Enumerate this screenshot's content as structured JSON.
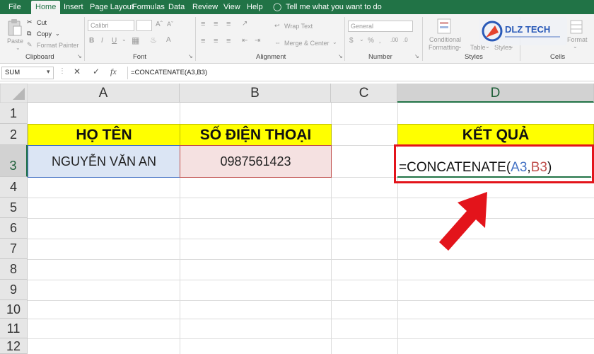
{
  "tabs": [
    "File",
    "Home",
    "Insert",
    "Page Layout",
    "Formulas",
    "Data",
    "Review",
    "View",
    "Help"
  ],
  "tell_me": "Tell me what you want to do",
  "ribbon": {
    "clipboard": {
      "paste": "Paste",
      "cut": "Cut",
      "copy": "Copy",
      "format_painter": "Format Painter",
      "label": "Clipboard"
    },
    "font": {
      "font_name": "Calibri",
      "label": "Font"
    },
    "alignment": {
      "wrap_text": "Wrap Text",
      "merge_center": "Merge & Center",
      "label": "Alignment"
    },
    "number": {
      "format": "General",
      "label": "Number"
    },
    "styles": {
      "conditional": "Conditional",
      "formatting": "Formatting",
      "table": "Table",
      "styles_btn": "Styles",
      "label": "Styles"
    },
    "cells": {
      "format": "Format",
      "label": "Cells"
    }
  },
  "logo_text": "DLZ TECH",
  "formula_bar": {
    "name_box": "SUM",
    "formula": "=CONCATENATE(A3,B3)"
  },
  "columns": [
    "A",
    "B",
    "C",
    "D"
  ],
  "rows": [
    "1",
    "2",
    "3",
    "4",
    "5",
    "6",
    "7",
    "8",
    "9",
    "10",
    "11",
    "12"
  ],
  "cells": {
    "A2": "HỌ TÊN",
    "B2": "SỐ ĐIỆN THOẠI",
    "D2": "KẾT QUẢ",
    "A3": "NGUYỄN VĂN AN",
    "B3": "0987561423"
  },
  "editing_formula": {
    "prefix": "=CONCATENATE(",
    "ref1": "A3",
    "comma": ",",
    "ref2": "B3",
    "suffix": ")"
  },
  "colors": {
    "excel_green": "#217346",
    "header_fill": "#ffff00",
    "ref1_color": "#4472c4",
    "ref2_color": "#c0504d",
    "annotation_red": "#e3141b"
  }
}
